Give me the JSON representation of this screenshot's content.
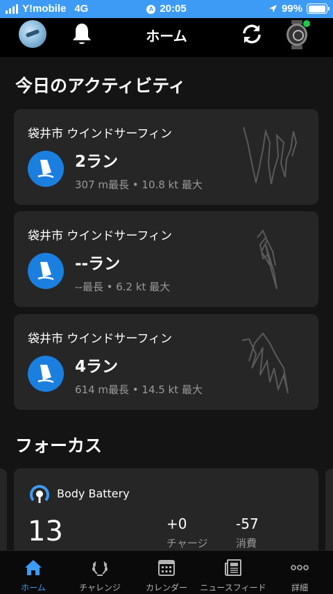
{
  "status_bar": {
    "carrier": "Y!mobile",
    "network": "4G",
    "time": "20:05",
    "battery": "99%",
    "battery_level": 0.99
  },
  "header": {
    "title": "ホーム"
  },
  "today_section": {
    "title": "今日のアクティビティ",
    "activities": [
      {
        "location": "袋井市 ウインドサーフィン",
        "runs": "2ラン",
        "stats": "307 m最長 • 10.8 kt 最大"
      },
      {
        "location": "袋井市 ウインドサーフィン",
        "runs": "--ラン",
        "stats": "--最長 • 6.2 kt 最大"
      },
      {
        "location": "袋井市 ウインドサーフィン",
        "runs": "4ラン",
        "stats": "614 m最長 • 14.5 kt 最大"
      }
    ]
  },
  "focus_section": {
    "title": "フォーカス",
    "body_battery": {
      "title": "Body Battery",
      "value": "13",
      "charge_value": "+0",
      "charge_label": "チャージ",
      "drain_value": "-57",
      "drain_label": "消費"
    }
  },
  "tab_bar": {
    "tabs": [
      {
        "label": "ホーム",
        "icon": "home-icon"
      },
      {
        "label": "チャレンジ",
        "icon": "laurel-icon"
      },
      {
        "label": "カレンダー",
        "icon": "calendar-icon"
      },
      {
        "label": "ニュースフィード",
        "icon": "newsfeed-icon"
      },
      {
        "label": "詳細",
        "icon": "more-icon"
      }
    ]
  },
  "colors": {
    "accent": "#3d9bf5",
    "activity_icon": "#1b7fe0",
    "card_bg": "#262626",
    "page_bg": "#141414",
    "watch_status": "#1ec84b"
  }
}
